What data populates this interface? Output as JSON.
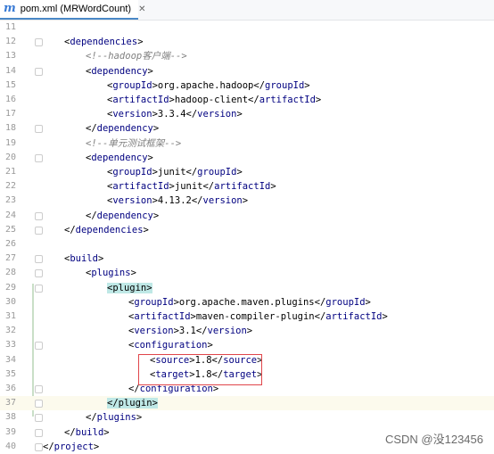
{
  "tab": {
    "icon": "maven-pom-file-icon",
    "icon_glyph": "m",
    "label": "pom.xml (MRWordCount)",
    "close_glyph": "✕"
  },
  "lines": [
    {
      "n": "11",
      "indent": 0,
      "parts": []
    },
    {
      "n": "12",
      "indent": 1,
      "parts": [
        {
          "t": "br",
          "v": "<"
        },
        {
          "t": "tag",
          "v": "dependencies"
        },
        {
          "t": "br",
          "v": ">"
        }
      ]
    },
    {
      "n": "13",
      "indent": 2,
      "parts": [
        {
          "t": "cmt",
          "v": "<!--hadoop客户端-->"
        }
      ]
    },
    {
      "n": "14",
      "indent": 2,
      "parts": [
        {
          "t": "br",
          "v": "<"
        },
        {
          "t": "tag",
          "v": "dependency"
        },
        {
          "t": "br",
          "v": ">"
        }
      ]
    },
    {
      "n": "15",
      "indent": 3,
      "parts": [
        {
          "t": "br",
          "v": "<"
        },
        {
          "t": "tag",
          "v": "groupId"
        },
        {
          "t": "br",
          "v": ">org.apache.hadoop</"
        },
        {
          "t": "tag",
          "v": "groupId"
        },
        {
          "t": "br",
          "v": ">"
        }
      ]
    },
    {
      "n": "16",
      "indent": 3,
      "parts": [
        {
          "t": "br",
          "v": "<"
        },
        {
          "t": "tag",
          "v": "artifactId"
        },
        {
          "t": "br",
          "v": ">hadoop-client</"
        },
        {
          "t": "tag",
          "v": "artifactId"
        },
        {
          "t": "br",
          "v": ">"
        }
      ]
    },
    {
      "n": "17",
      "indent": 3,
      "parts": [
        {
          "t": "br",
          "v": "<"
        },
        {
          "t": "tag",
          "v": "version"
        },
        {
          "t": "br",
          "v": ">3.3.4</"
        },
        {
          "t": "tag",
          "v": "version"
        },
        {
          "t": "br",
          "v": ">"
        }
      ]
    },
    {
      "n": "18",
      "indent": 2,
      "parts": [
        {
          "t": "br",
          "v": "</"
        },
        {
          "t": "tag",
          "v": "dependency"
        },
        {
          "t": "br",
          "v": ">"
        }
      ]
    },
    {
      "n": "19",
      "indent": 2,
      "parts": [
        {
          "t": "cmt",
          "v": "<!--单元测试框架-->"
        }
      ]
    },
    {
      "n": "20",
      "indent": 2,
      "parts": [
        {
          "t": "br",
          "v": "<"
        },
        {
          "t": "tag",
          "v": "dependency"
        },
        {
          "t": "br",
          "v": ">"
        }
      ]
    },
    {
      "n": "21",
      "indent": 3,
      "parts": [
        {
          "t": "br",
          "v": "<"
        },
        {
          "t": "tag",
          "v": "groupId"
        },
        {
          "t": "br",
          "v": ">junit</"
        },
        {
          "t": "tag",
          "v": "groupId"
        },
        {
          "t": "br",
          "v": ">"
        }
      ]
    },
    {
      "n": "22",
      "indent": 3,
      "parts": [
        {
          "t": "br",
          "v": "<"
        },
        {
          "t": "tag",
          "v": "artifactId"
        },
        {
          "t": "br",
          "v": ">junit</"
        },
        {
          "t": "tag",
          "v": "artifactId"
        },
        {
          "t": "br",
          "v": ">"
        }
      ]
    },
    {
      "n": "23",
      "indent": 3,
      "parts": [
        {
          "t": "br",
          "v": "<"
        },
        {
          "t": "tag",
          "v": "version"
        },
        {
          "t": "br",
          "v": ">4.13.2</"
        },
        {
          "t": "tag",
          "v": "version"
        },
        {
          "t": "br",
          "v": ">"
        }
      ]
    },
    {
      "n": "24",
      "indent": 2,
      "parts": [
        {
          "t": "br",
          "v": "</"
        },
        {
          "t": "tag",
          "v": "dependency"
        },
        {
          "t": "br",
          "v": ">"
        }
      ]
    },
    {
      "n": "25",
      "indent": 1,
      "parts": [
        {
          "t": "br",
          "v": "</"
        },
        {
          "t": "tag",
          "v": "dependencies"
        },
        {
          "t": "br",
          "v": ">"
        }
      ]
    },
    {
      "n": "26",
      "indent": 0,
      "parts": []
    },
    {
      "n": "27",
      "indent": 1,
      "parts": [
        {
          "t": "br",
          "v": "<"
        },
        {
          "t": "tag",
          "v": "build"
        },
        {
          "t": "br",
          "v": ">"
        }
      ]
    },
    {
      "n": "28",
      "indent": 2,
      "parts": [
        {
          "t": "br",
          "v": "<"
        },
        {
          "t": "tag",
          "v": "plugins"
        },
        {
          "t": "br",
          "v": ">"
        }
      ]
    },
    {
      "n": "29",
      "indent": 3,
      "parts": [
        {
          "t": "hl",
          "v": "<plugin>"
        }
      ]
    },
    {
      "n": "30",
      "indent": 4,
      "parts": [
        {
          "t": "br",
          "v": "<"
        },
        {
          "t": "tag",
          "v": "groupId"
        },
        {
          "t": "br",
          "v": ">org.apache.maven.plugins</"
        },
        {
          "t": "tag",
          "v": "groupId"
        },
        {
          "t": "br",
          "v": ">"
        }
      ]
    },
    {
      "n": "31",
      "indent": 4,
      "parts": [
        {
          "t": "br",
          "v": "<"
        },
        {
          "t": "tag",
          "v": "artifactId"
        },
        {
          "t": "br",
          "v": ">maven-compiler-plugin</"
        },
        {
          "t": "tag",
          "v": "artifactId"
        },
        {
          "t": "br",
          "v": ">"
        }
      ]
    },
    {
      "n": "32",
      "indent": 4,
      "parts": [
        {
          "t": "br",
          "v": "<"
        },
        {
          "t": "tag",
          "v": "version"
        },
        {
          "t": "br",
          "v": ">3.1</"
        },
        {
          "t": "tag",
          "v": "version"
        },
        {
          "t": "br",
          "v": ">"
        }
      ]
    },
    {
      "n": "33",
      "indent": 4,
      "parts": [
        {
          "t": "br",
          "v": "<"
        },
        {
          "t": "tag",
          "v": "configuration"
        },
        {
          "t": "br",
          "v": ">"
        }
      ]
    },
    {
      "n": "34",
      "indent": 5,
      "parts": [
        {
          "t": "br",
          "v": "<"
        },
        {
          "t": "tag",
          "v": "source"
        },
        {
          "t": "br",
          "v": ">1.8</"
        },
        {
          "t": "tag",
          "v": "source"
        },
        {
          "t": "br",
          "v": ">"
        }
      ]
    },
    {
      "n": "35",
      "indent": 5,
      "parts": [
        {
          "t": "br",
          "v": "<"
        },
        {
          "t": "tag",
          "v": "target"
        },
        {
          "t": "br",
          "v": ">1.8</"
        },
        {
          "t": "tag",
          "v": "target"
        },
        {
          "t": "br",
          "v": ">"
        }
      ]
    },
    {
      "n": "36",
      "indent": 4,
      "parts": [
        {
          "t": "br",
          "v": "</"
        },
        {
          "t": "tag",
          "v": "configuration"
        },
        {
          "t": "br",
          "v": ">"
        }
      ]
    },
    {
      "n": "37",
      "indent": 3,
      "current": true,
      "parts": [
        {
          "t": "hl",
          "v": "</plugin>"
        }
      ]
    },
    {
      "n": "38",
      "indent": 2,
      "parts": [
        {
          "t": "br",
          "v": "</"
        },
        {
          "t": "tag",
          "v": "plugins"
        },
        {
          "t": "br",
          "v": ">"
        }
      ]
    },
    {
      "n": "39",
      "indent": 1,
      "parts": [
        {
          "t": "br",
          "v": "</"
        },
        {
          "t": "tag",
          "v": "build"
        },
        {
          "t": "br",
          "v": ">"
        }
      ]
    },
    {
      "n": "40",
      "indent": 0,
      "parts": [
        {
          "t": "br",
          "v": "</"
        },
        {
          "t": "tag",
          "v": "project"
        },
        {
          "t": "br",
          "v": ">"
        }
      ]
    }
  ],
  "watermark": "CSDN @没123456",
  "colors": {
    "tag": "#000080",
    "comment": "#808080",
    "matched_tag_highlight": "#bfe8e6",
    "current_line": "#fcfaed",
    "annotation_box": "#e0454a"
  }
}
